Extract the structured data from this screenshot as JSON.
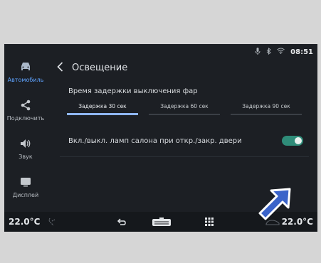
{
  "status": {
    "time": "08:51",
    "icons": [
      "mic-icon",
      "bluetooth-icon",
      "wifi-icon"
    ]
  },
  "sidebar": {
    "items": [
      {
        "label": "Автомобиль",
        "icon": "car-icon",
        "active": true
      },
      {
        "label": "Подключить",
        "icon": "share-icon",
        "active": false
      },
      {
        "label": "Звук",
        "icon": "speaker-icon",
        "active": false
      },
      {
        "label": "Дисплей",
        "icon": "display-icon",
        "active": false
      }
    ]
  },
  "header": {
    "title": "Освещение"
  },
  "headlight_delay": {
    "label": "Время задержки выключения фар",
    "options": [
      "Задержка 30 сек",
      "Задержка 60 сек",
      "Задержка 90 сек"
    ],
    "selected_index": 0
  },
  "interior_lamp": {
    "label": "Вкл./выкл. ламп салона при откр./закр. двери",
    "enabled": true
  },
  "bottom": {
    "temp_left": "22.0°C",
    "temp_right": "22.0°C"
  },
  "colors": {
    "accent": "#5ea3ff",
    "toggle_on": "#2f8c79",
    "arrow": "#3a63c9"
  }
}
